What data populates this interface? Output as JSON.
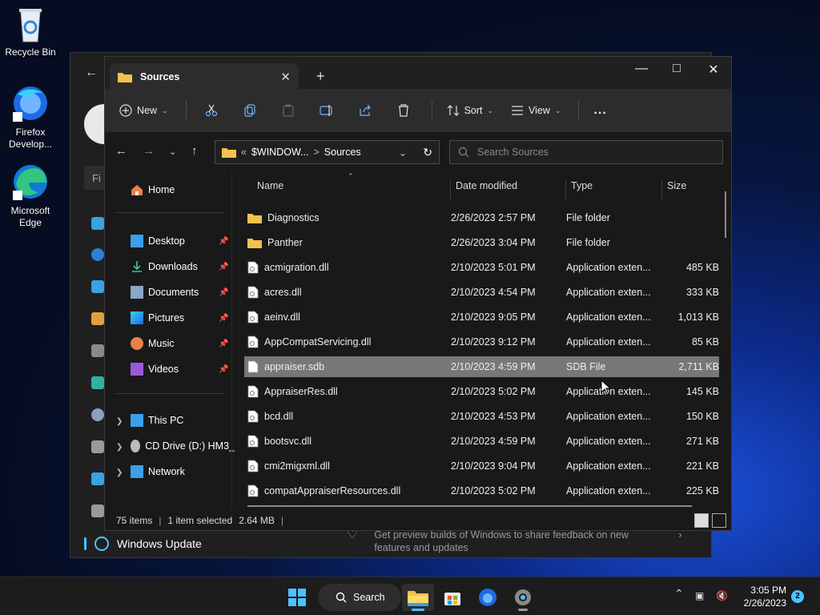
{
  "desktop": {
    "icons": [
      {
        "label": "Recycle Bin",
        "icon": "recycle-bin-icon"
      },
      {
        "label": "Firefox Develop...",
        "icon": "firefox-developer-icon"
      },
      {
        "label": "Microsoft Edge",
        "icon": "edge-icon"
      }
    ]
  },
  "settings_window": {
    "search_placeholder": "Fi",
    "nav_selected": "Windows Update",
    "preview_text": "Get preview builds of Windows to share feedback on new features and updates"
  },
  "explorer": {
    "tab_title": "Sources",
    "toolbar": {
      "new_label": "New",
      "sort_label": "Sort",
      "view_label": "View",
      "more_label": "..."
    },
    "address": {
      "overflow": "«",
      "segment1": "$WINDOW...",
      "separator": ">",
      "segment2": "Sources"
    },
    "search_placeholder": "Search Sources",
    "sidebar": {
      "home": "Home",
      "quick_access": [
        {
          "label": "Desktop"
        },
        {
          "label": "Downloads"
        },
        {
          "label": "Documents"
        },
        {
          "label": "Pictures"
        },
        {
          "label": "Music"
        },
        {
          "label": "Videos"
        }
      ],
      "this_pc": "This PC",
      "cd_drive": "CD Drive (D:) HM3_",
      "network": "Network"
    },
    "columns": {
      "name": "Name",
      "date": "Date modified",
      "type": "Type",
      "size": "Size"
    },
    "files": [
      {
        "name": "Diagnostics",
        "date": "2/26/2023 2:57 PM",
        "type": "File folder",
        "size": "",
        "kind": "folder"
      },
      {
        "name": "Panther",
        "date": "2/26/2023 3:04 PM",
        "type": "File folder",
        "size": "",
        "kind": "folder"
      },
      {
        "name": "acmigration.dll",
        "date": "2/10/2023 5:01 PM",
        "type": "Application exten...",
        "size": "485 KB",
        "kind": "dll"
      },
      {
        "name": "acres.dll",
        "date": "2/10/2023 4:54 PM",
        "type": "Application exten...",
        "size": "333 KB",
        "kind": "dll"
      },
      {
        "name": "aeinv.dll",
        "date": "2/10/2023 9:05 PM",
        "type": "Application exten...",
        "size": "1,013 KB",
        "kind": "dll"
      },
      {
        "name": "AppCompatServicing.dll",
        "date": "2/10/2023 9:12 PM",
        "type": "Application exten...",
        "size": "85 KB",
        "kind": "dll"
      },
      {
        "name": "appraiser.sdb",
        "date": "2/10/2023 4:59 PM",
        "type": "SDB File",
        "size": "2,711 KB",
        "kind": "file",
        "selected": true
      },
      {
        "name": "AppraiserRes.dll",
        "date": "2/10/2023 5:02 PM",
        "type": "Application exten...",
        "size": "145 KB",
        "kind": "dll"
      },
      {
        "name": "bcd.dll",
        "date": "2/10/2023 4:53 PM",
        "type": "Application exten...",
        "size": "150 KB",
        "kind": "dll"
      },
      {
        "name": "bootsvc.dll",
        "date": "2/10/2023 4:59 PM",
        "type": "Application exten...",
        "size": "271 KB",
        "kind": "dll"
      },
      {
        "name": "cmi2migxml.dll",
        "date": "2/10/2023 9:04 PM",
        "type": "Application exten...",
        "size": "221 KB",
        "kind": "dll"
      },
      {
        "name": "compatAppraiserResources.dll",
        "date": "2/10/2023 5:02 PM",
        "type": "Application exten...",
        "size": "225 KB",
        "kind": "dll"
      }
    ],
    "status": {
      "items": "75 items",
      "selected": "1 item selected",
      "size": "2.64 MB"
    }
  },
  "taskbar": {
    "search_label": "Search",
    "time": "3:05 PM",
    "date": "2/26/2023",
    "notifications": "2"
  },
  "colors": {
    "accent": "#4cc2ff",
    "folder": "#f3c24f",
    "selection": "#777777"
  }
}
